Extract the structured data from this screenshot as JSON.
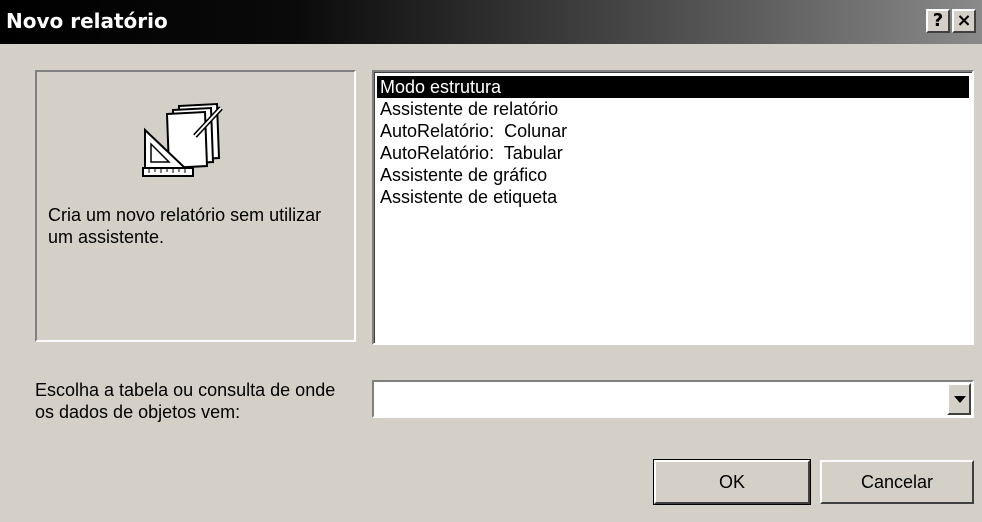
{
  "window": {
    "title": "Novo relatório",
    "help_label": "?",
    "close_label": "×"
  },
  "preview": {
    "icon": "report-design-icon",
    "description": "Cria um novo relatório sem utilizar um assistente."
  },
  "list": {
    "items": [
      "Modo estrutura",
      "Assistente de relatório",
      "AutoRelatório:  Colunar",
      "AutoRelatório:  Tabular",
      "Assistente de gráfico",
      "Assistente de etiqueta"
    ],
    "selected": "Modo estrutura"
  },
  "source": {
    "prompt": "Escolha a tabela ou consulta de onde os dados de objetos vem:",
    "value": ""
  },
  "buttons": {
    "ok": "OK",
    "cancel": "Cancelar"
  },
  "colors": {
    "dialog_bg": "#d4d0c8",
    "selection_bg": "#000000",
    "selection_fg": "#ffffff"
  }
}
